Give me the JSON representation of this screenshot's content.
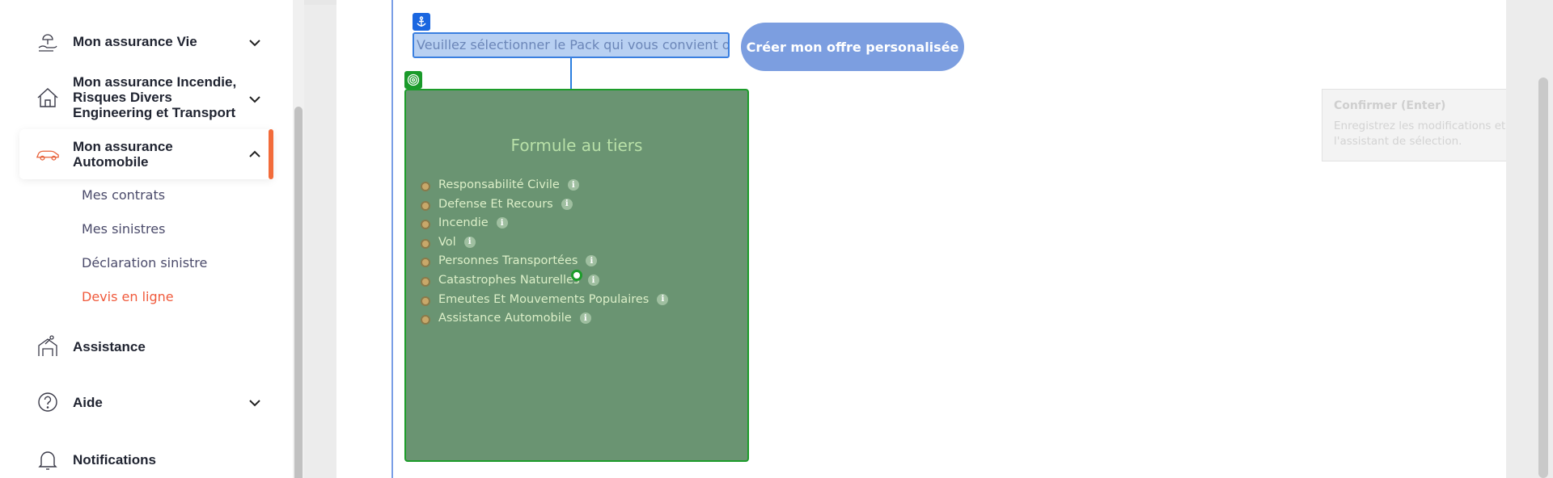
{
  "sidebar": {
    "items": [
      {
        "label": "Mon assurance Vie",
        "icon": "umbrella-hand-icon",
        "has_chevron": true
      },
      {
        "label": "Mon assurance Incendie, Risques Divers Engineering et Transport",
        "label_lines": [
          "Mon assurance Incendie,",
          "Risques Divers",
          "Engineering et Transport"
        ],
        "icon": "house-icon",
        "has_chevron": true
      },
      {
        "label": "Mon assurance Automobile",
        "label_lines": [
          "Mon assurance",
          "Automobile"
        ],
        "icon": "car-icon",
        "expanded": true
      },
      {
        "label": "Assistance",
        "icon": "assistance-icon"
      },
      {
        "label": "Aide",
        "icon": "question-icon",
        "has_chevron": true
      },
      {
        "label": "Notifications",
        "icon": "bell-icon"
      }
    ],
    "auto_subitems": [
      "Mes contrats",
      "Mes sinistres",
      "Déclaration sinistre",
      "Devis en ligne"
    ],
    "active_subitem": "Devis en ligne"
  },
  "main": {
    "pack_prompt": "Veuillez sélectionner le Pack qui vous convient ou",
    "create_offer_label": "Créer mon offre personalisée",
    "formula": {
      "title": "Formule au tiers",
      "coverages": [
        "Responsabilité Civile",
        "Defense Et Recours",
        "Incendie",
        "Vol",
        "Personnes Transportées",
        "Catastrophes Naturelles",
        "Emeutes Et Mouvements Populaires",
        "Assistance Automobile"
      ]
    }
  },
  "tooltip": {
    "title": "Confirmer (Enter)",
    "description": "Enregistrez les modifications et fermez l'assistant de sélection."
  },
  "colors": {
    "accent_orange": "#f26b3a",
    "active_link": "#f05a3c",
    "button_blue": "#7c9ee0",
    "card_green": "#6a9472",
    "selection_blue": "#1a66e0"
  }
}
